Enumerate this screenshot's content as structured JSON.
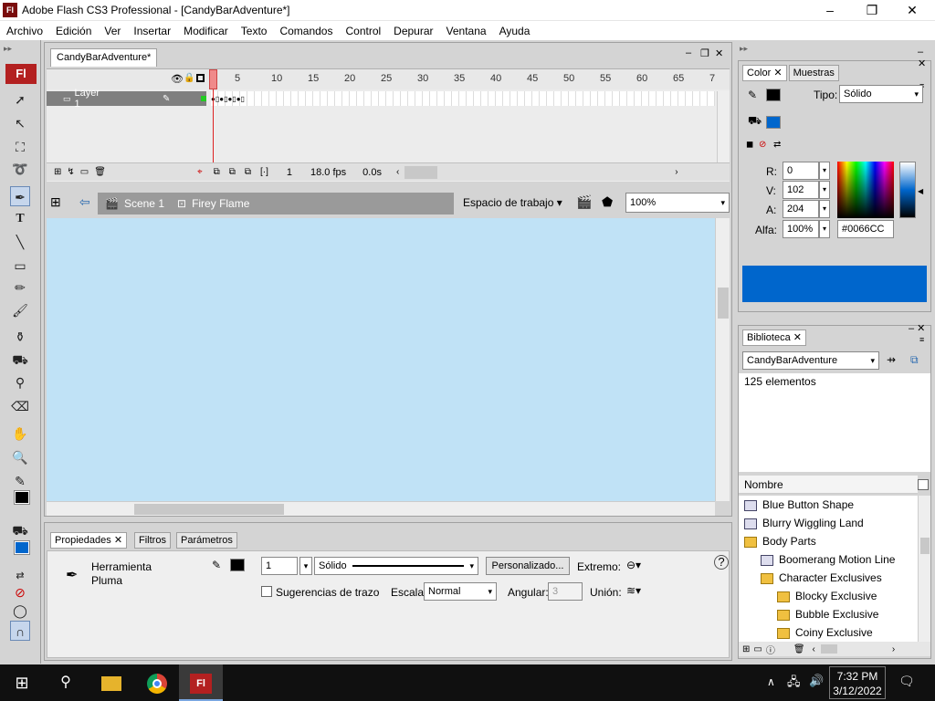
{
  "window": {
    "app_icon": "Fl",
    "title": "Adobe Flash CS3 Professional - [CandyBarAdventure*]",
    "controls": [
      "–",
      "❐",
      "✕"
    ]
  },
  "menu": [
    "Archivo",
    "Edición",
    "Ver",
    "Insertar",
    "Modificar",
    "Texto",
    "Comandos",
    "Control",
    "Depurar",
    "Ventana",
    "Ayuda"
  ],
  "tools_badge": "Fl",
  "document": {
    "tab": "CandyBarAdventure*",
    "panel_controls": [
      "–",
      "❐",
      "✕"
    ],
    "timeline": {
      "frame_numbers": [
        "1",
        "5",
        "10",
        "15",
        "20",
        "25",
        "30",
        "35",
        "40",
        "45",
        "50",
        "55",
        "60",
        "65",
        "7"
      ],
      "layer_name": "Layer 1",
      "current_frame": "1",
      "fps": "18.0 fps",
      "time": "0.0s"
    },
    "scene": {
      "scene_label": "Scene 1",
      "symbol_label": "Firey Flame",
      "workspace_label": "Espacio de trabajo",
      "zoom": "100%"
    },
    "stage_color": "#c0e2f6"
  },
  "properties": {
    "tabs": [
      "Propiedades",
      "Filtros",
      "Parámetros"
    ],
    "tool_name": "Herramienta\nPluma",
    "stroke_width": "1",
    "stroke_style": "Sólido",
    "custom_button": "Personalizado...",
    "cap_label": "Extremo:",
    "hint_label": "Sugerencias de trazo",
    "scale_label": "Escala:",
    "scale_value": "Normal",
    "angular_label": "Angular:",
    "angular_value": "3",
    "join_label": "Unión:",
    "help": "?"
  },
  "color_panel": {
    "tabs": [
      "Color",
      "Muestras"
    ],
    "type_label": "Tipo:",
    "type_value": "Sólido",
    "r_label": "R:",
    "r_value": "0",
    "g_label": "V:",
    "g_value": "102",
    "b_label": "A:",
    "b_value": "204",
    "alpha_label": "Alfa:",
    "alpha_value": "100%",
    "hex_value": "#0066CC",
    "swatch_color": "#0066cc"
  },
  "library": {
    "tab": "Biblioteca",
    "document": "CandyBarAdventure",
    "count": "125 elementos",
    "column": "Nombre",
    "items": [
      {
        "label": "Blue Button Shape",
        "indent": 0,
        "kind": "symbol"
      },
      {
        "label": "Blurry Wiggling Land",
        "indent": 0,
        "kind": "symbol"
      },
      {
        "label": "Body Parts",
        "indent": 0,
        "kind": "folder-open"
      },
      {
        "label": "Boomerang Motion Line",
        "indent": 1,
        "kind": "symbol"
      },
      {
        "label": "Character Exclusives",
        "indent": 1,
        "kind": "folder-open"
      },
      {
        "label": "Blocky Exclusive",
        "indent": 2,
        "kind": "folder"
      },
      {
        "label": "Bubble Exclusive",
        "indent": 2,
        "kind": "folder"
      },
      {
        "label": "Coiny Exclusive",
        "indent": 2,
        "kind": "folder"
      }
    ]
  },
  "taskbar": {
    "time": "7:32 PM",
    "date": "3/12/2022",
    "flash_label": "Fl"
  }
}
